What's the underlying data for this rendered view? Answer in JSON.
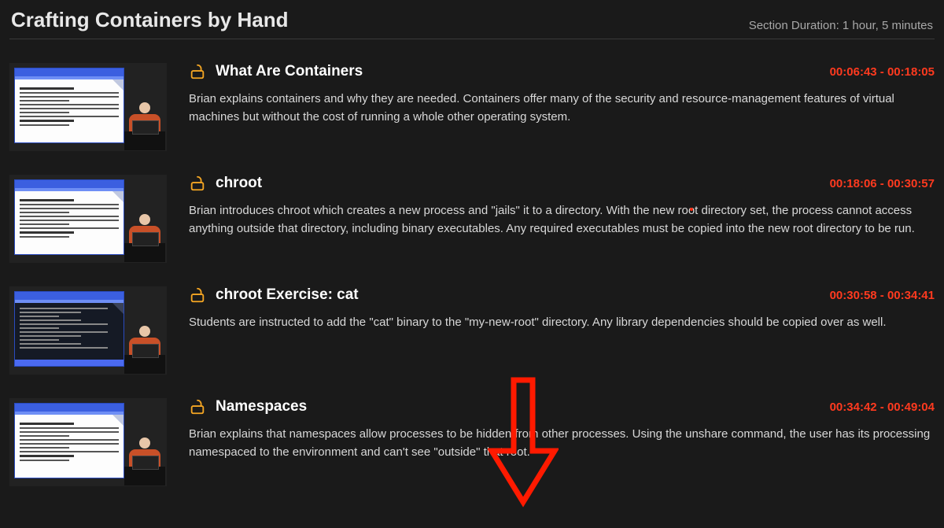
{
  "section": {
    "title": "Crafting Containers by Hand",
    "duration_label": "Section Duration: 1 hour, 5 minutes"
  },
  "lessons": [
    {
      "title": "What Are Containers",
      "timestamp": "00:06:43 - 00:18:05",
      "description": "Brian explains containers and why they are needed. Containers offer many of the security and resource-management features of virtual machines but without the cost of running a whole other operating system.",
      "thumb_style": "doc"
    },
    {
      "title": "chroot",
      "timestamp": "00:18:06 - 00:30:57",
      "description": "Brian introduces chroot which creates a new process and \"jails\" it to a directory. With the new root directory set, the process cannot access anything outside that directory, including binary executables. Any required executables must be copied into the new root directory to be run.",
      "thumb_style": "doc"
    },
    {
      "title": "chroot Exercise: cat",
      "timestamp": "00:30:58 - 00:34:41",
      "description": "Students are instructed to add the \"cat\" binary to the \"my-new-root\" directory. Any library dependencies should be copied over as well.",
      "thumb_style": "terminal"
    },
    {
      "title": "Namespaces",
      "timestamp": "00:34:42 - 00:49:04",
      "description": "Brian explains that namespaces allow processes to be hidden from other processes. Using the unshare command, the user has its processing namespaced to the environment and can't see \"outside\" that root.",
      "thumb_style": "doc"
    }
  ]
}
